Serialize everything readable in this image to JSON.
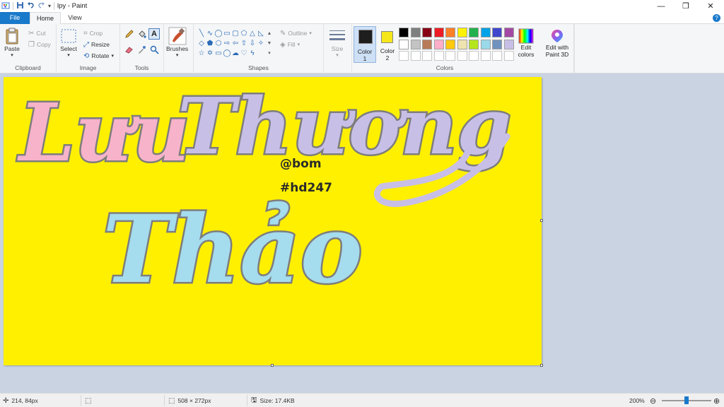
{
  "window": {
    "title": "lpy - Paint",
    "minimize": "—",
    "restore": "❐",
    "close": "✕"
  },
  "tabs": {
    "file": "File",
    "home": "Home",
    "view": "View",
    "help": "?"
  },
  "ribbon": {
    "clipboard": {
      "label": "Clipboard",
      "paste": "Paste",
      "cut": "Cut",
      "copy": "Copy"
    },
    "image": {
      "label": "Image",
      "select": "Select",
      "crop": "Crop",
      "resize": "Resize",
      "rotate": "Rotate"
    },
    "tools": {
      "label": "Tools"
    },
    "brushes": {
      "label": "Brushes"
    },
    "shapes": {
      "label": "Shapes",
      "outline": "Outline",
      "fill": "Fill"
    },
    "size": {
      "label": "Size"
    },
    "color1": {
      "label": "Color",
      "num": "1",
      "value": "#1e1e1e"
    },
    "color2": {
      "label": "Color",
      "num": "2",
      "value": "#f5e71a"
    },
    "colors": {
      "label": "Colors",
      "edit_line1": "Edit",
      "edit_line2": "colors",
      "row1": [
        "#000000",
        "#7f7f7f",
        "#880015",
        "#ed1c24",
        "#ff7f27",
        "#fff200",
        "#22b14c",
        "#00a2e8",
        "#3f48cc",
        "#a349a4"
      ],
      "row2": [
        "#ffffff",
        "#c3c3c3",
        "#b97a57",
        "#ffaec9",
        "#ffc90e",
        "#efe4b0",
        "#b5e61d",
        "#99d9ea",
        "#7092be",
        "#c8bfe7"
      ]
    },
    "paint3d": {
      "line1": "Edit with",
      "line2": "Paint 3D"
    }
  },
  "canvas": {
    "background": "#fff000",
    "text": {
      "name1": "Lưu",
      "name2": "Thương",
      "name3": "Thảo",
      "handle1": "@bom",
      "handle2": "#hd247"
    },
    "colors": {
      "pink": "#f7b3c9",
      "lavender": "#c8bfe7",
      "skyblue": "#a5dcee",
      "outline": "#7d7d7d"
    }
  },
  "status": {
    "cursor": "214, 84px",
    "selection": "",
    "dimensions": "508 × 272px",
    "size": "Size: 17.4KB",
    "zoom": "200%",
    "zoom_fraction": 0.5
  }
}
